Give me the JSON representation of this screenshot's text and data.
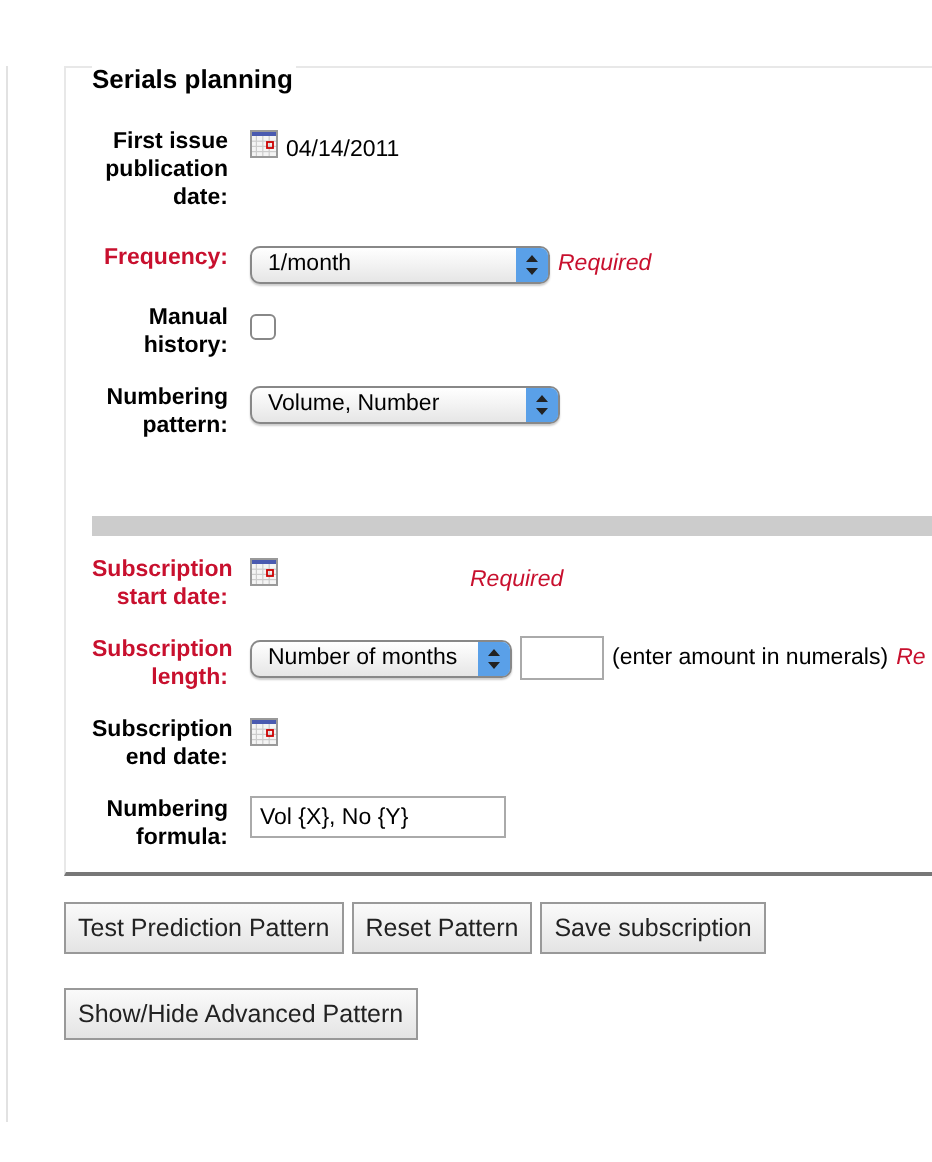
{
  "section": {
    "title": "Serials planning"
  },
  "groups": [
    {
      "fields": [
        {
          "label": "First issue publication date:",
          "kind": "date",
          "required": false,
          "value": "04/14/2011"
        },
        {
          "label": "Frequency:",
          "kind": "select",
          "required": true,
          "value": "1/month",
          "note": "Required"
        },
        {
          "label": "Manual history:",
          "kind": "checkbox",
          "required": false,
          "checked": false
        },
        {
          "label": "Numbering pattern:",
          "kind": "select",
          "required": false,
          "value": "Volume, Number"
        }
      ]
    },
    {
      "fields": [
        {
          "label": "Subscription start date:",
          "kind": "date",
          "required": true,
          "note": "Required"
        },
        {
          "label": "Subscription length:",
          "kind": "length",
          "required": true,
          "value": "Number of months",
          "hint": "(enter amount in numerals)",
          "note": "Re"
        },
        {
          "label": "Subscription end date:",
          "kind": "date",
          "required": false
        },
        {
          "label": "Numbering formula:",
          "kind": "text",
          "required": false,
          "value": "Vol {X}, No {Y}"
        }
      ]
    }
  ],
  "button_rows": [
    [
      "Test Prediction Pattern",
      "Reset Pattern",
      "Save subscription"
    ],
    [
      "Show/Hide Advanced Pattern"
    ]
  ]
}
